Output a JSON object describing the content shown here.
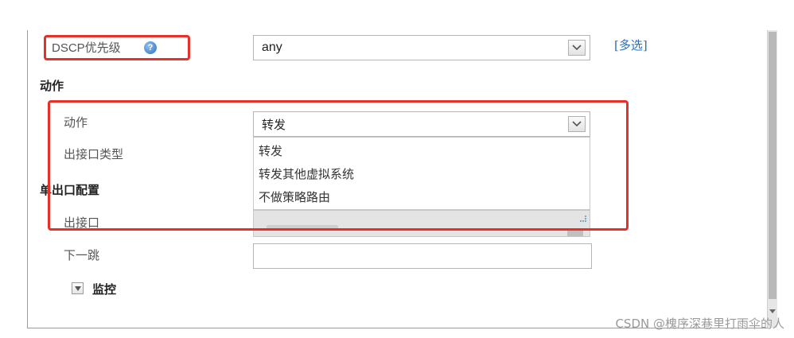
{
  "form": {
    "dscp_label": "DSCP优先级",
    "dscp_value": "any",
    "multi_select_link": "[多选]",
    "action_section": "动作",
    "action_label": "动作",
    "action_value": "转发",
    "egress_type_label": "出接口类型",
    "single_egress_section": "单出口配置",
    "egress_label": "出接口",
    "next_hop_label": "下一跳",
    "monitor_section": "监控"
  },
  "dropdown": {
    "options": [
      "转发",
      "转发其他虚拟系统",
      "不做策略路由"
    ]
  },
  "watermark": "CSDN @槐序深巷里打雨伞的人",
  "colors": {
    "annotation_red": "#e8302a",
    "link_blue": "#2a6fb8"
  },
  "icons": {
    "help": "question-circle-icon",
    "select_caret": "chevron-down-icon",
    "collapse": "triangle-down-icon"
  }
}
